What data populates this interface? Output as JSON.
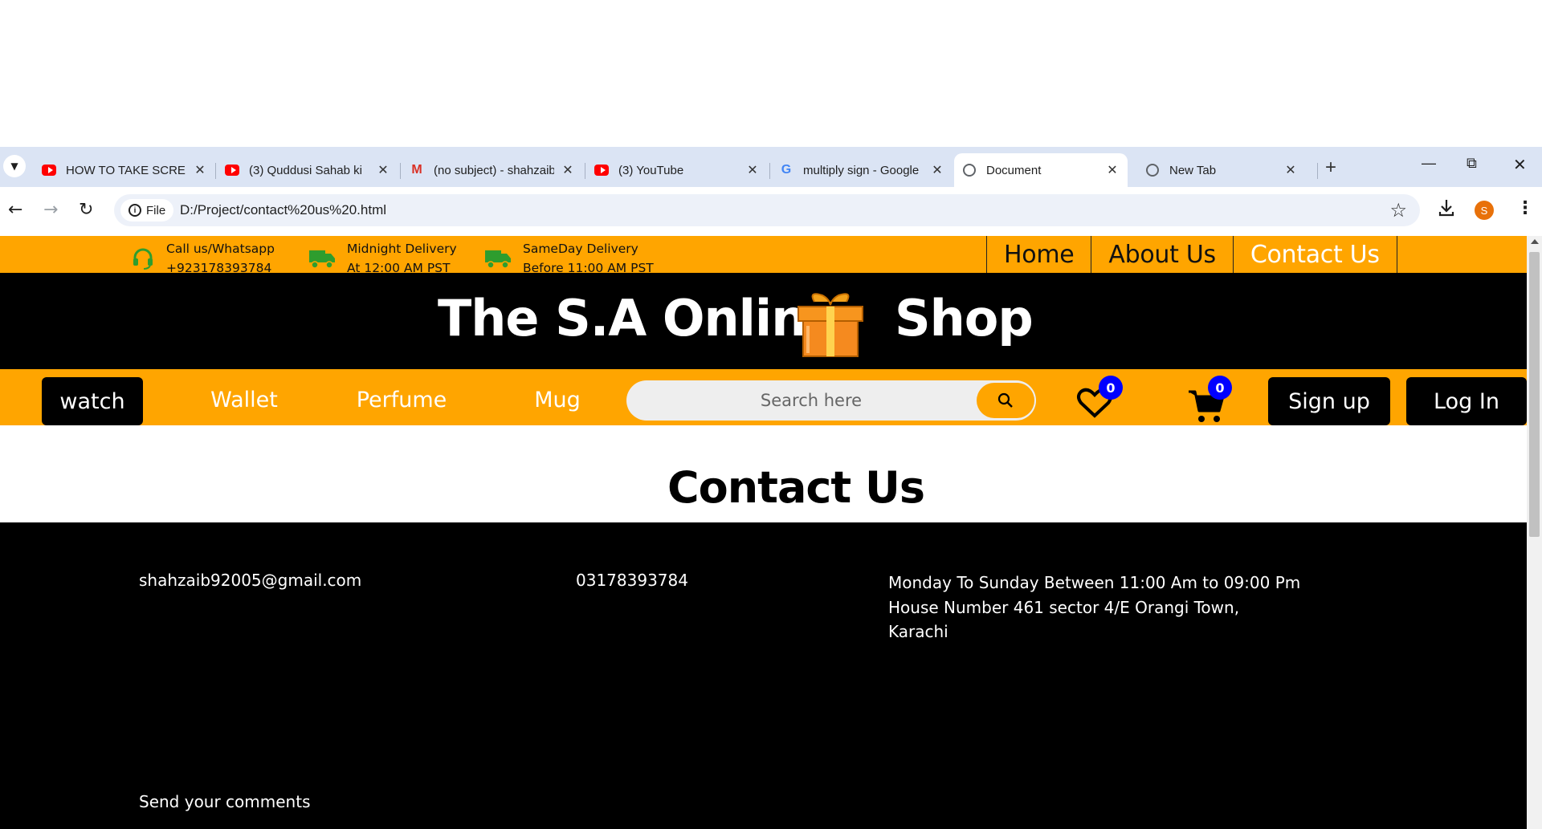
{
  "browser": {
    "tabs": [
      {
        "title": "HOW TO TAKE SCREENSHOT",
        "icon": "youtube-icon"
      },
      {
        "title": "(3) Quddusi Sahab ki",
        "icon": "youtube-icon"
      },
      {
        "title": "(no subject) - shahzaib",
        "icon": "gmail-icon"
      },
      {
        "title": "(3) YouTube",
        "icon": "youtube-icon"
      },
      {
        "title": "multiply sign - Google",
        "icon": "google-icon"
      },
      {
        "title": "Document",
        "icon": "globe-icon",
        "active": true
      },
      {
        "title": "New Tab",
        "icon": "chrome-icon"
      }
    ],
    "site_chip": "File",
    "url": "D:/Project/contact%20us%20.html",
    "profile_initial": "S"
  },
  "topbar": {
    "call_line1": "Call us/Whatsapp",
    "call_line2": "+923178393784",
    "midnight_line1": "Midnight Delivery",
    "midnight_line2": "At 12:00 AM PST",
    "sameday_line1": "SameDay Delivery",
    "sameday_line2": "Before 11:00 AM PST",
    "nav": {
      "home": "Home",
      "about": "About Us",
      "contact": "Contact Us"
    }
  },
  "brand": {
    "left": "The S.A Online",
    "right": "Shop"
  },
  "categories": {
    "watch": "watch",
    "wallet": "Wallet",
    "perfume": "Perfume",
    "mug": "Mug"
  },
  "search": {
    "placeholder": "Search here"
  },
  "wishlist_count": "0",
  "cart_count": "0",
  "auth": {
    "signup": "Sign up",
    "login": "Log In"
  },
  "contact": {
    "title": "Contact Us",
    "email": "shahzaib92005@gmail.com",
    "phone": "03178393784",
    "hours": "Monday To Sunday Between 11:00 Am to 09:00 Pm",
    "address_line1": "House Number 461 sector 4/E Orangi Town,",
    "address_line2": "Karachi",
    "send_comments": "Send your comments"
  },
  "colors": {
    "accent": "#ffa500",
    "dark": "#000000",
    "badge": "#0000ff",
    "icon_green": "#2e9d2e"
  }
}
